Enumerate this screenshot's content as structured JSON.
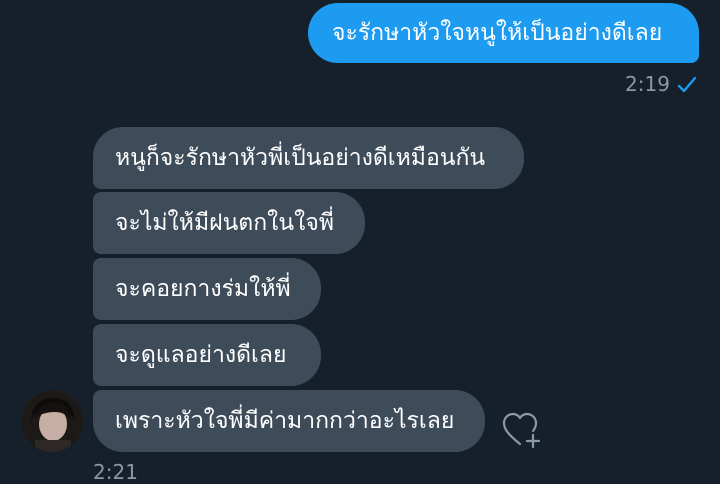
{
  "sent_messages": [
    {
      "text": "จะรักษาหัวใจหนูให้เป็นอย่างดีเลย"
    }
  ],
  "sent_time": "2:19",
  "received_messages": [
    {
      "text": "หนูก็จะรักษาหัวพี่เป็นอย่างดีเหมือนกัน"
    },
    {
      "text": "จะไม่ให้มีฝนตกในใจพี่"
    },
    {
      "text": "จะคอยกางร่มให้พี่"
    },
    {
      "text": "จะดูแลอย่างดีเลย"
    },
    {
      "text": "เพราะหัวใจพี่มีค่ามากกว่าอะไรเลย"
    }
  ],
  "received_time": "2:21",
  "icons": {
    "read_status": "check-icon",
    "react": "heart-plus-icon",
    "avatar": "avatar"
  },
  "colors": {
    "background": "#15202b",
    "sent_bubble": "#1d9bf0",
    "received_bubble": "#3e4c5a",
    "meta_text": "#8b98a5",
    "check": "#1d9bf0"
  }
}
